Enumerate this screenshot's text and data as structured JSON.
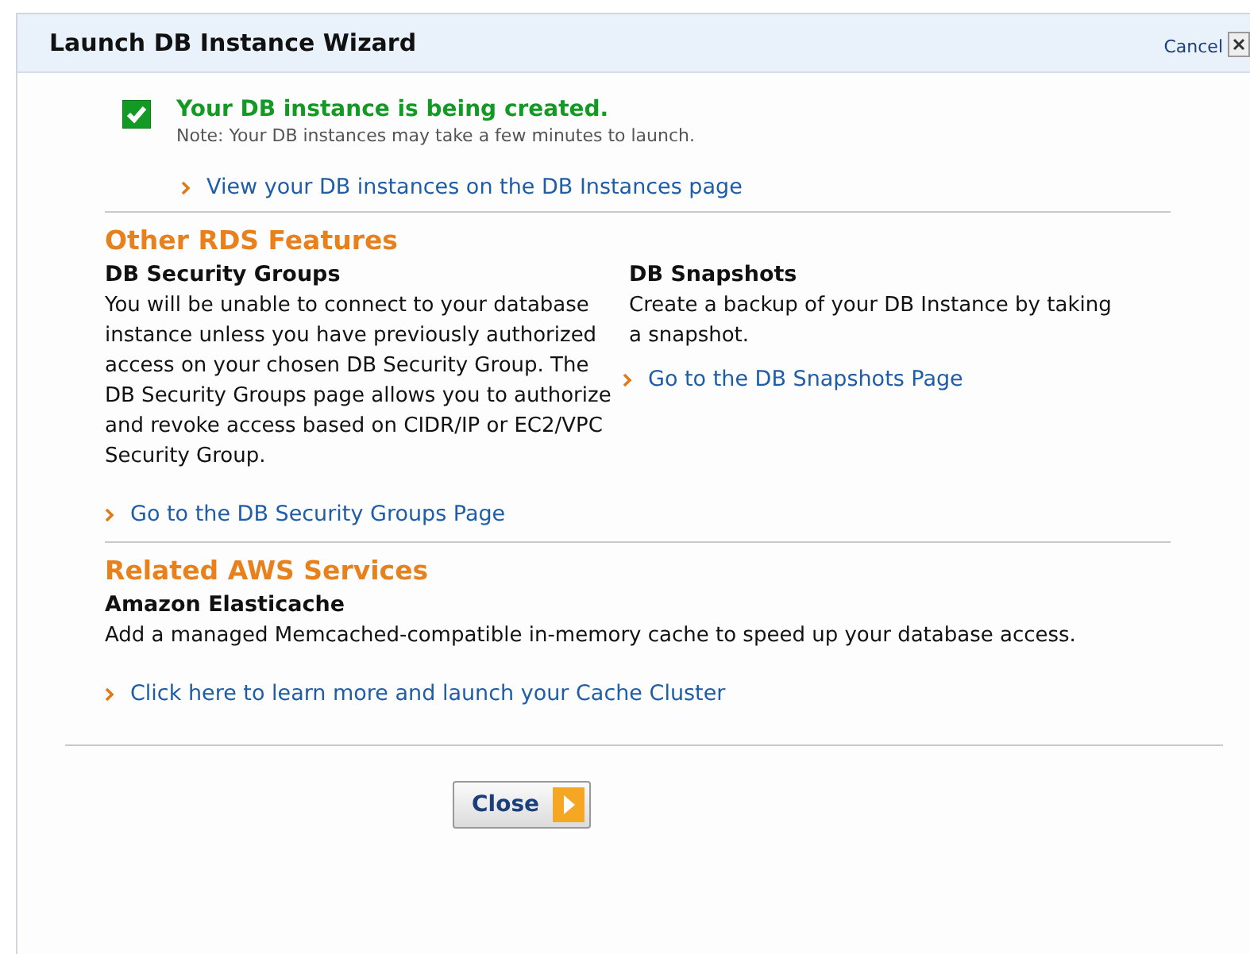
{
  "window": {
    "title": "Launch DB Instance Wizard",
    "cancel": "Cancel"
  },
  "status": {
    "checked": true,
    "message": "Your DB instance is being created.",
    "note": "Note: Your DB instances may take a few minutes to launch.",
    "link": "View your DB instances on the DB Instances page"
  },
  "sections": [
    {
      "heading": "Other RDS Features",
      "columns": [
        {
          "title": "DB Security Groups",
          "text": "You will be unable to connect to your database instance unless you have previously authorized access on your chosen DB Security Group. The DB Security Groups page allows you to authorize and revoke access based on CIDR/IP or EC2/VPC Security Group.",
          "link": "Go to the DB Security Groups Page"
        },
        {
          "title": "DB Snapshots",
          "text": "Create a backup of your DB Instance by taking a snapshot.",
          "link": "Go to the DB Snapshots Page"
        }
      ]
    },
    {
      "heading": "Related AWS Services",
      "columns": [
        {
          "title": "Amazon Elasticache",
          "text": "Add a managed Memcached-compatible in-memory cache to speed up your database access.",
          "link": "Click here to learn more and launch your Cache Cluster"
        }
      ]
    }
  ],
  "buttons": [
    {
      "label": "Close"
    }
  ]
}
